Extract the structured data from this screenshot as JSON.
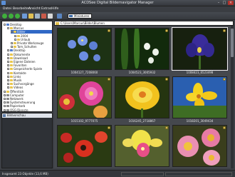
{
  "window": {
    "title": "ACDSee Digital Bildernavigator Manager"
  },
  "menu": [
    "Datei",
    "Bearbeiten",
    "Ansicht",
    "Extras",
    "Hilfe"
  ],
  "toolbar": {
    "buttons": [
      "back-icon",
      "forward-icon",
      "up-icon",
      "refresh-icon",
      "favorites-icon",
      "view-icon",
      "slideshow-icon",
      "home-icon",
      "thumbnails-icon"
    ],
    "field_value": "Miniaturen"
  },
  "tree": [
    {
      "label": "Desktop",
      "depth": 0,
      "exp": "-",
      "icon": "blue"
    },
    {
      "label": "Marcus",
      "depth": 1,
      "exp": "-",
      "icon": "yellow"
    },
    {
      "label": "Bilder",
      "depth": 2,
      "exp": "-",
      "icon": "yellow",
      "selected": true
    },
    {
      "label": "2004",
      "depth": 3,
      "exp": "+",
      "icon": "yellow"
    },
    {
      "label": "Urlaub",
      "depth": 3,
      "exp": "+",
      "icon": "yellow"
    },
    {
      "label": "Private Werkzeuge",
      "depth": 2,
      "exp": "+",
      "icon": "yellow"
    },
    {
      "label": "Tom_Schulten",
      "depth": 2,
      "exp": "+",
      "icon": "yellow"
    },
    {
      "label": "Desktop",
      "depth": 1,
      "exp": "+",
      "icon": "blue"
    },
    {
      "label": "Dokumente",
      "depth": 1,
      "exp": "+",
      "icon": "yellow"
    },
    {
      "label": "Download",
      "depth": 1,
      "exp": "+",
      "icon": "yellow"
    },
    {
      "label": "Eigene Dateien",
      "depth": 1,
      "exp": "+",
      "icon": "yellow"
    },
    {
      "label": "Favoriten",
      "depth": 1,
      "exp": "+",
      "icon": "yellow"
    },
    {
      "label": "Gespeicherte Spiele",
      "depth": 1,
      "exp": "+",
      "icon": "yellow"
    },
    {
      "label": "Kontakte",
      "depth": 1,
      "exp": "+",
      "icon": "yellow"
    },
    {
      "label": "Links",
      "depth": 1,
      "exp": "+",
      "icon": "yellow"
    },
    {
      "label": "Musik",
      "depth": 1,
      "exp": "+",
      "icon": "yellow"
    },
    {
      "label": "Suchvorgänge",
      "depth": 1,
      "exp": "+",
      "icon": "yellow"
    },
    {
      "label": "Videos",
      "depth": 1,
      "exp": "+",
      "icon": "yellow"
    },
    {
      "label": "Öffentlich",
      "depth": 0,
      "exp": "+",
      "icon": "yellow"
    },
    {
      "label": "Computer",
      "depth": 0,
      "exp": "+",
      "icon": "gray"
    },
    {
      "label": "Netzwerk",
      "depth": 0,
      "exp": "+",
      "icon": "gray"
    },
    {
      "label": "Systemsteuerung",
      "depth": 0,
      "exp": "+",
      "icon": "gray"
    },
    {
      "label": "Papierkorb",
      "depth": 0,
      "exp": "+",
      "icon": "gray"
    },
    {
      "label": "QSG-Dienste",
      "depth": 0,
      "exp": "+",
      "icon": "gray"
    }
  ],
  "preview": {
    "title": "Bildvorschau"
  },
  "address": {
    "path": "C:\\Users\\Marcus\\Bilder\\Blumen"
  },
  "thumbnails": [
    {
      "caption": "1004127_7208060",
      "theme": "blue-flowers"
    },
    {
      "caption": "1004523_3005932",
      "theme": "white-bells"
    },
    {
      "caption": "1008423_6523498",
      "theme": "purple-iris"
    },
    {
      "caption": "1015102_9777075",
      "theme": "pink-red"
    },
    {
      "caption": "1016245_2718867",
      "theme": "yellow-cup"
    },
    {
      "caption": "1018201_3049434",
      "theme": "yellow-lily"
    },
    {
      "caption": "",
      "theme": "red-poppy"
    },
    {
      "caption": "",
      "theme": "yellow-orchid"
    },
    {
      "caption": "",
      "theme": "pink-daisy"
    }
  ],
  "status": {
    "text": "Insgesamt 23 Objekte  (13,6 MB)"
  },
  "colors": {
    "selection": "#3169c6",
    "folder": "#e8c650",
    "panel_bg": "#45484d"
  }
}
